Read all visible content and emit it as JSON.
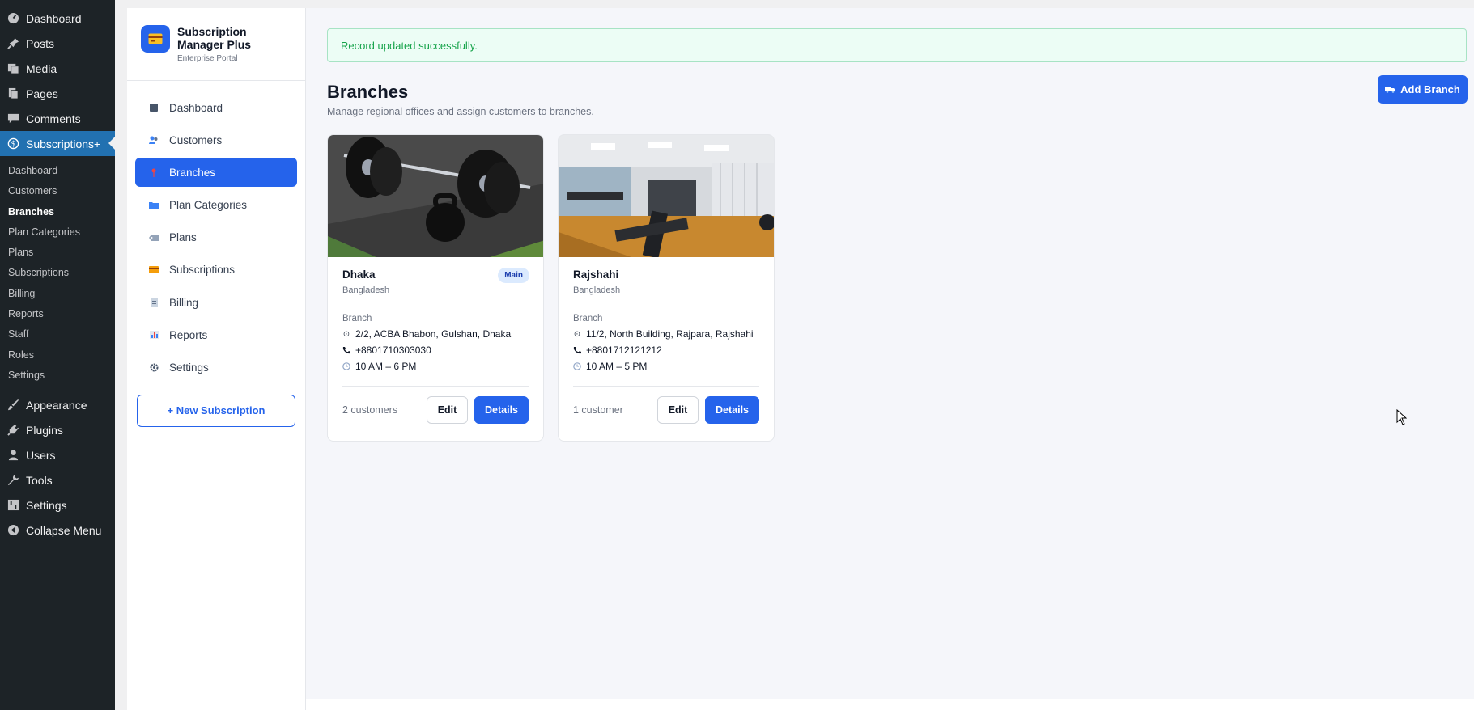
{
  "wp_menu": {
    "items_top": [
      {
        "label": "Dashboard",
        "icon": "dashboard-icon"
      },
      {
        "label": "Posts",
        "icon": "pin-icon"
      },
      {
        "label": "Media",
        "icon": "media-icon"
      },
      {
        "label": "Pages",
        "icon": "pages-icon"
      },
      {
        "label": "Comments",
        "icon": "comments-icon"
      },
      {
        "label": "Subscriptions+",
        "icon": "dollar-icon"
      }
    ],
    "submenu": [
      "Dashboard",
      "Customers",
      "Branches",
      "Plan Categories",
      "Plans",
      "Subscriptions",
      "Billing",
      "Reports",
      "Staff",
      "Roles",
      "Settings"
    ],
    "current_submenu": "Branches",
    "items_bottom": [
      {
        "label": "Appearance",
        "icon": "brush-icon"
      },
      {
        "label": "Plugins",
        "icon": "plugin-icon"
      },
      {
        "label": "Users",
        "icon": "user-icon"
      },
      {
        "label": "Tools",
        "icon": "wrench-icon"
      },
      {
        "label": "Settings",
        "icon": "settings-icon"
      },
      {
        "label": "Collapse Menu",
        "icon": "collapse-icon"
      }
    ]
  },
  "plugin": {
    "title_line1": "Subscription",
    "title_line2": "Manager Plus",
    "subtitle": "Enterprise Portal",
    "nav": [
      {
        "label": "Dashboard",
        "icon": "grid-icon"
      },
      {
        "label": "Customers",
        "icon": "users-icon"
      },
      {
        "label": "Branches",
        "icon": "pin-icon"
      },
      {
        "label": "Plan Categories",
        "icon": "folder-icon"
      },
      {
        "label": "Plans",
        "icon": "tag-icon"
      },
      {
        "label": "Subscriptions",
        "icon": "card-icon"
      },
      {
        "label": "Billing",
        "icon": "receipt-icon"
      },
      {
        "label": "Reports",
        "icon": "chart-icon"
      },
      {
        "label": "Settings",
        "icon": "gear-icon"
      }
    ],
    "active_nav": "Branches",
    "new_subscription": "+  New Subscription"
  },
  "main": {
    "notice": "Record updated successfully.",
    "title": "Branches",
    "subtitle": "Manage regional offices and assign customers to branches.",
    "add_button": "Add Branch",
    "branches": [
      {
        "name": "Dhaka",
        "country": "Bangladesh",
        "badge": "Main",
        "type": "Branch",
        "address": "2/2, ACBA Bhabon, Gulshan, Dhaka",
        "phone": "+8801710303030",
        "hours": "10 AM – 6 PM",
        "customers": "2 customers",
        "edit": "Edit",
        "details": "Details"
      },
      {
        "name": "Rajshahi",
        "country": "Bangladesh",
        "type": "Branch",
        "address": "11/2, North Building, Rajpara, Rajshahi",
        "phone": "+8801712121212",
        "hours": "10 AM – 5 PM",
        "customers": "1 customer",
        "edit": "Edit",
        "details": "Details"
      }
    ]
  }
}
